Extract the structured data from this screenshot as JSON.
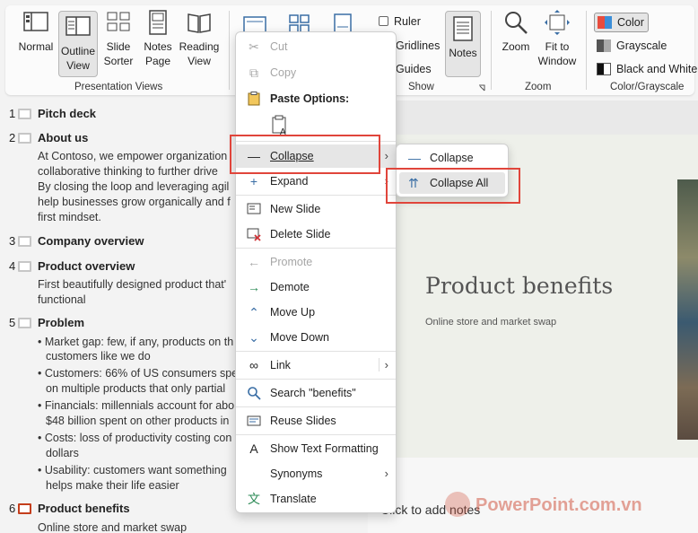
{
  "ribbon": {
    "buttons": {
      "normal": "Normal",
      "outline_view_1": "Outline",
      "outline_view_2": "View",
      "slide_sorter_1": "Slide",
      "slide_sorter_2": "Sorter",
      "notes_page_1": "Notes",
      "notes_page_2": "Page",
      "reading_view_1": "Reading",
      "reading_view_2": "View",
      "notes": "Notes",
      "zoom": "Zoom",
      "fit_window_1": "Fit to",
      "fit_window_2": "Window"
    },
    "checks": {
      "ruler": "Ruler",
      "gridlines": "Gridlines",
      "guides": "Guides"
    },
    "color_options": {
      "color": "Color",
      "grayscale": "Grayscale",
      "black_white": "Black and White"
    },
    "groups": {
      "presentation_views": "Presentation Views",
      "show": "Show",
      "zoom": "Zoom",
      "color_grayscale": "Color/Grayscale"
    }
  },
  "outline": {
    "slides": [
      {
        "num": "1",
        "title": "Pitch deck"
      },
      {
        "num": "2",
        "title": "About us"
      },
      {
        "num": "3",
        "title": "Company overview"
      },
      {
        "num": "4",
        "title": "Product overview"
      },
      {
        "num": "5",
        "title": "Problem"
      },
      {
        "num": "6",
        "title": "Product benefits"
      }
    ],
    "about_lines": [
      "At Contoso, we empower organization",
      "collaborative thinking to further drive",
      "By closing the loop and leveraging agil",
      "help businesses grow organically and f",
      "first mindset."
    ],
    "product_lines": [
      "First beautifully designed product that'",
      "functional"
    ],
    "problem_bullets": [
      "• Market gap: few, if any, products on th",
      "customers like we do",
      "• Customers: 66% of US consumers spe",
      "on multiple products that only partial",
      "• Financials: millennials account for abo",
      "$48 billion spent on other products in",
      "• Costs: loss of productivity costing con",
      "dollars",
      "• Usability: customers want something",
      "helps make their life easier"
    ],
    "benefits_sub": "Online store and market swap"
  },
  "slide": {
    "title": "Product benefits",
    "subtitle": "Online store and market swap",
    "notes_placeholder": "Click to add notes"
  },
  "context_menu": {
    "cut": "Cut",
    "copy": "Copy",
    "paste_options": "Paste Options:",
    "collapse": "Collapse",
    "expand": "Expand",
    "new_slide": "New Slide",
    "delete_slide": "Delete Slide",
    "promote": "Promote",
    "demote": "Demote",
    "move_up": "Move Up",
    "move_down": "Move Down",
    "link": "Link",
    "search": "Search \"benefits\"",
    "reuse_slides": "Reuse Slides",
    "show_text_formatting": "Show Text Formatting",
    "synonyms": "Synonyms",
    "translate": "Translate"
  },
  "submenu": {
    "collapse": "Collapse",
    "collapse_all": "Collapse All"
  },
  "watermark": "PowerPoint.com.vn",
  "colors": {
    "highlight": "#e0453b",
    "accent_red": "#c43e1c"
  }
}
